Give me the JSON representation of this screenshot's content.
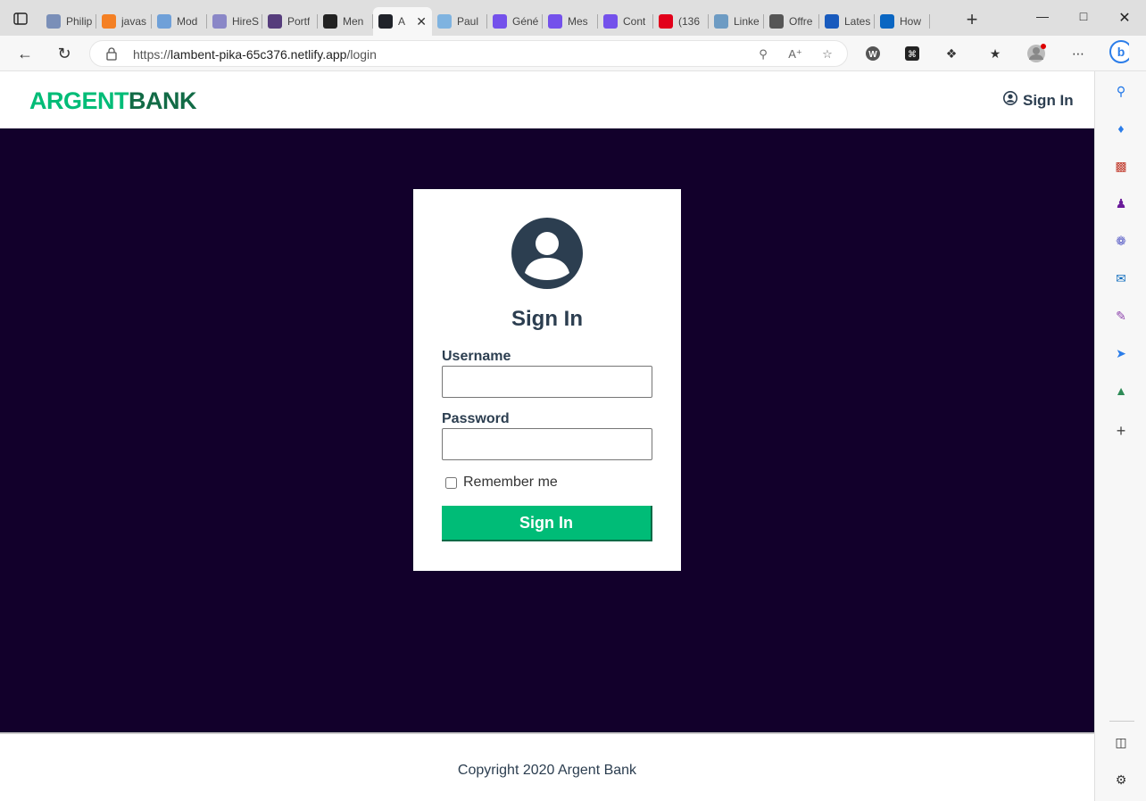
{
  "browser": {
    "tabs": [
      {
        "label": "Philip",
        "icon": "printer-icon",
        "color": "#7a8fb8"
      },
      {
        "label": "javas",
        "icon": "stackoverflow-icon",
        "color": "#f48024"
      },
      {
        "label": "Mod",
        "icon": "diamond-icon",
        "color": "#6fa0d8"
      },
      {
        "label": "HireS",
        "icon": "hire-icon",
        "color": "#8a87c7"
      },
      {
        "label": "Portf",
        "icon": "bootstrap-icon",
        "color": "#563d7c"
      },
      {
        "label": "Men",
        "icon": "github-icon",
        "color": "#222222"
      },
      {
        "label": "A",
        "icon": "react-icon",
        "color": "#20232a",
        "active": true
      },
      {
        "label": "Paul",
        "icon": "code-icon",
        "color": "#7fb3e0"
      },
      {
        "label": "Géné",
        "icon": "openclassrooms-icon",
        "color": "#7451eb"
      },
      {
        "label": "Mes",
        "icon": "openclassrooms-icon",
        "color": "#7451eb"
      },
      {
        "label": "Cont",
        "icon": "openclassrooms-icon",
        "color": "#7451eb"
      },
      {
        "label": "(136",
        "icon": "sfr-icon",
        "color": "#e2001a"
      },
      {
        "label": "Linke",
        "icon": "linkedin-icon",
        "color": "#6d9bc3"
      },
      {
        "label": "Offre",
        "icon": "m-icon",
        "color": "#555555"
      },
      {
        "label": "Lates",
        "icon": "word-icon",
        "color": "#185abd"
      },
      {
        "label": "How",
        "icon": "linkedin-icon",
        "color": "#0a66c2"
      }
    ],
    "url_prefix": "https://",
    "url_host": "lambent-pika-65c376.netlify.app",
    "url_path": "/login"
  },
  "header": {
    "logo_part1": "ARGENT",
    "logo_part2": "BANK",
    "signin_label": "Sign In"
  },
  "form": {
    "title": "Sign In",
    "username_label": "Username",
    "username_value": "",
    "password_label": "Password",
    "password_value": "",
    "remember_label": "Remember me",
    "remember_checked": false,
    "submit_label": "Sign In"
  },
  "footer": {
    "copyright": "Copyright 2020 Argent Bank"
  },
  "colors": {
    "brand_green": "#00bc77",
    "brand_dark_green": "#126b46",
    "background_dark": "#12002b",
    "text_dark": "#2c3e50"
  }
}
